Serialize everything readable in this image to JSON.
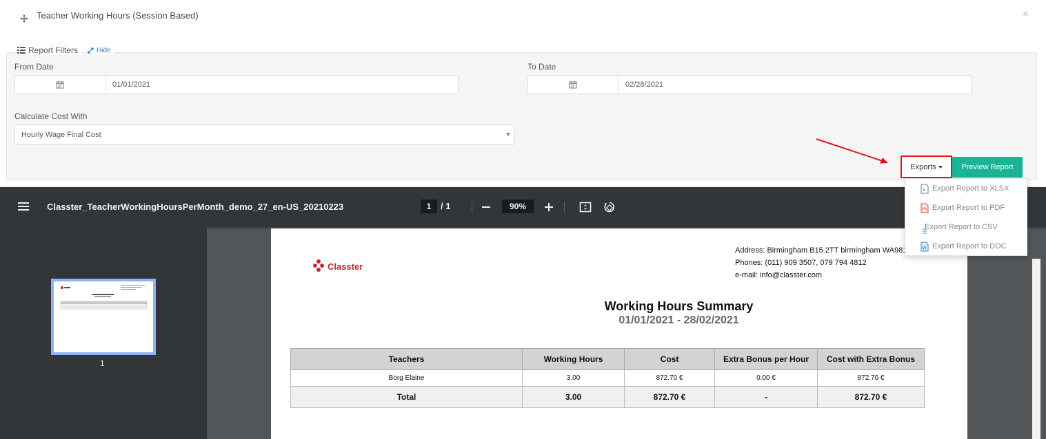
{
  "header": {
    "title": "Teacher Working Hours (Session Based)",
    "close_glyph": "×"
  },
  "filters": {
    "legend": "Report Filters",
    "hide_label": "Hide",
    "from_label": "From Date",
    "from_value": "01/01/2021",
    "to_label": "To Date",
    "to_value": "02/28/2021",
    "cost_label": "Calculate Cost With",
    "cost_value": "Hourly Wage Final Cost"
  },
  "actions": {
    "exports_label": "Exports",
    "preview_label": "Preview Report",
    "highlight_color": "#e0161b",
    "preview_color": "#1ab394"
  },
  "export_menu": [
    {
      "label": "Export Report to XLSX",
      "icon": "xlsx-file-icon"
    },
    {
      "label": "Export Report to PDF",
      "icon": "pdf-file-icon"
    },
    {
      "label": "Export Report to CSV",
      "icon": "csv-file-icon"
    },
    {
      "label": "Export Report to DOC",
      "icon": "doc-file-icon"
    }
  ],
  "viewer": {
    "filename": "Classter_TeacherWorkingHoursPerMonth_demo_27_en-US_20210223",
    "page_current": "1",
    "page_separator": "/ 1",
    "zoom": "90%",
    "thumb_number": "1"
  },
  "document": {
    "brand": "Classter",
    "address": "Address: Birmingham B15 2TT  birmingham WA981",
    "phones": "Phones: (011) 909 3507, 079 794 4812",
    "email": "e-mail: info@classter.com",
    "title": "Working Hours Summary",
    "date_range": "01/01/2021 - 28/02/2021",
    "table": {
      "headers": [
        "Teachers",
        "Working Hours",
        "Cost",
        "Extra Bonus per Hour",
        "Cost with Extra Bonus"
      ],
      "rows": [
        [
          "Borg Elaine",
          "3.00",
          "872.70 €",
          "0.00 €",
          "872.70 €"
        ]
      ],
      "total": [
        "Total",
        "3.00",
        "872.70 €",
        "-",
        "872.70 €"
      ]
    }
  }
}
